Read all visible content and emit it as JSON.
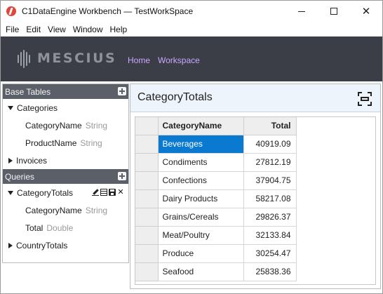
{
  "window": {
    "title": "C1DataEngine Workbench — TestWorkSpace",
    "controls": {
      "minimize": "minimize",
      "maximize": "maximize",
      "close": "✕"
    }
  },
  "menu": [
    "File",
    "Edit",
    "View",
    "Window",
    "Help"
  ],
  "header": {
    "brand": "MESCIUS",
    "nav": [
      "Home",
      "Workspace"
    ]
  },
  "sidebar": {
    "base_tables": {
      "label": "Base Tables",
      "categories": {
        "label": "Categories",
        "fields": [
          {
            "name": "CategoryName",
            "type": "String"
          },
          {
            "name": "ProductName",
            "type": "String"
          }
        ]
      },
      "invoices": {
        "label": "Invoices"
      }
    },
    "queries": {
      "label": "Queries",
      "category_totals": {
        "label": "CategoryTotals",
        "fields": [
          {
            "name": "CategoryName",
            "type": "String"
          },
          {
            "name": "Total",
            "type": "Double"
          }
        ]
      },
      "country_totals": {
        "label": "CountryTotals"
      }
    }
  },
  "main": {
    "title": "CategoryTotals",
    "grid": {
      "columns": [
        "CategoryName",
        "Total"
      ],
      "rows": [
        {
          "name": "Beverages",
          "total": "40919.09"
        },
        {
          "name": "Condiments",
          "total": "27812.19"
        },
        {
          "name": "Confections",
          "total": "37904.75"
        },
        {
          "name": "Dairy Products",
          "total": "58217.08"
        },
        {
          "name": "Grains/Cereals",
          "total": "29826.37"
        },
        {
          "name": "Meat/Poultry",
          "total": "32133.84"
        },
        {
          "name": "Produce",
          "total": "30254.47"
        },
        {
          "name": "Seafood",
          "total": "25838.36"
        }
      ],
      "selected_row": 0
    }
  },
  "colors": {
    "brand_bar": "#3b3e46",
    "nav_link": "#c9a8ff",
    "section_header": "#5b5f67",
    "selection": "#0a7ad1"
  }
}
